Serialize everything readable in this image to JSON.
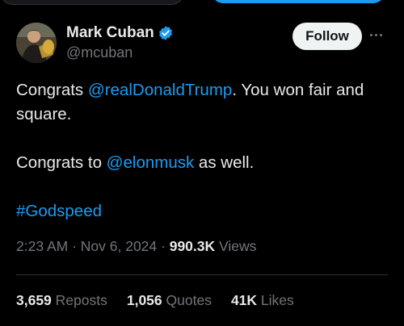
{
  "author": {
    "name": "Mark Cuban",
    "handle": "@mcuban",
    "verified_color": "#1d9bf0"
  },
  "follow_button": {
    "label": "Follow"
  },
  "more_button": {
    "icon": "more-horizontal-icon"
  },
  "tweet": {
    "line1_prefix": "Congrats ",
    "line1_mention": "@realDonaldTrump",
    "line1_suffix": ".  You won fair and square.",
    "line2_prefix": "Congrats to ",
    "line2_mention": "@elonmusk",
    "line2_suffix": " as well.",
    "hashtag": "#Godspeed"
  },
  "meta": {
    "time": "2:23 AM",
    "sep1": " · ",
    "date": "Nov 6, 2024",
    "sep2": " · ",
    "views_count": "990.3K",
    "views_label": " Views"
  },
  "stats": {
    "reposts_count": "3,659",
    "reposts_label": " Reposts",
    "quotes_count": "1,056",
    "quotes_label": " Quotes",
    "likes_count": "41K",
    "likes_label": " Likes"
  },
  "colors": {
    "background": "#000000",
    "text": "#e7e9ea",
    "muted": "#71767b",
    "link": "#1d9bf0",
    "divider": "#2f3336"
  }
}
